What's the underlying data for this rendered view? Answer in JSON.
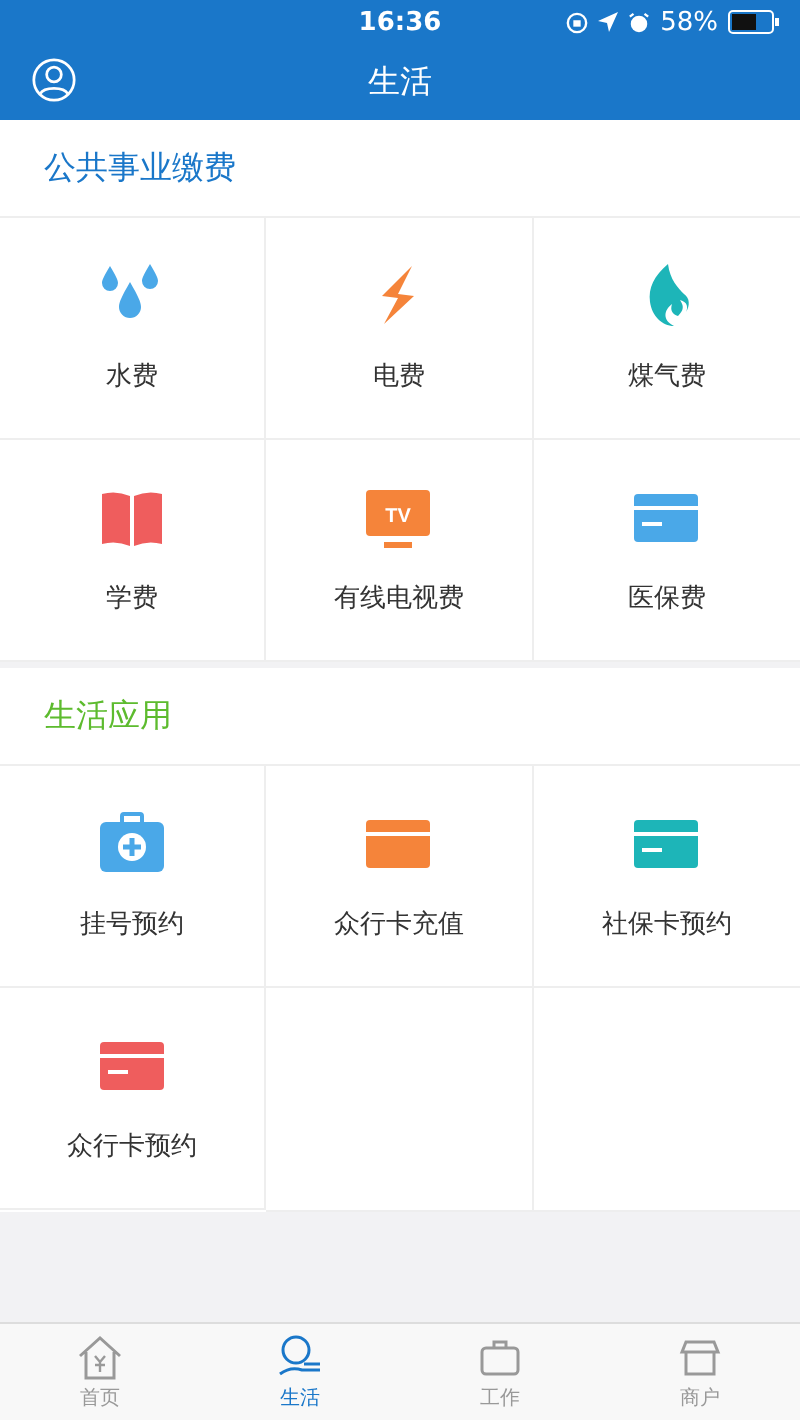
{
  "status_bar": {
    "time": "16:36",
    "battery": "58%"
  },
  "nav": {
    "title": "生活"
  },
  "sections": [
    {
      "title": "公共事业缴费",
      "color": "#1a77c9",
      "tiles": [
        {
          "label": "水费",
          "kind": "drops"
        },
        {
          "label": "电费",
          "kind": "bolt"
        },
        {
          "label": "煤气费",
          "kind": "flame"
        },
        {
          "label": "学费",
          "kind": "book"
        },
        {
          "label": "有线电视费",
          "kind": "tv",
          "icon_text": "TV"
        },
        {
          "label": "医保费",
          "kind": "card-blue"
        }
      ]
    },
    {
      "title": "生活应用",
      "color": "#5dbb2e",
      "tiles": [
        {
          "label": "挂号预约",
          "kind": "medkit"
        },
        {
          "label": "众行卡充值",
          "kind": "card-orange"
        },
        {
          "label": "社保卡预约",
          "kind": "card-teal"
        },
        {
          "label": "众行卡预约",
          "kind": "card-red"
        }
      ]
    }
  ],
  "tabs": [
    {
      "label": "首页",
      "kind": "home",
      "selected": false
    },
    {
      "label": "生活",
      "kind": "life",
      "selected": true
    },
    {
      "label": "工作",
      "kind": "work",
      "selected": false
    },
    {
      "label": "商户",
      "kind": "shop",
      "selected": false
    }
  ]
}
